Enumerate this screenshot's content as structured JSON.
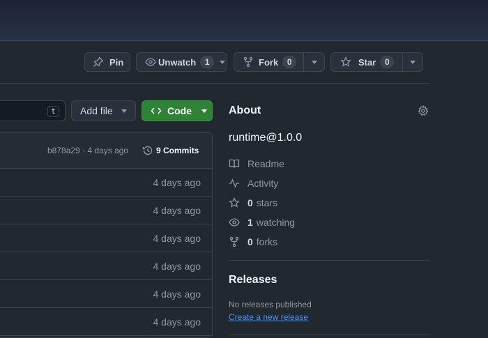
{
  "header": {
    "pin": {
      "label": "Pin"
    },
    "unwatch": {
      "label": "Unwatch",
      "count": "1"
    },
    "fork": {
      "label": "Fork",
      "count": "0"
    },
    "star": {
      "label": "Star",
      "count": "0"
    }
  },
  "toolbar": {
    "search_shortcut": "t",
    "add_file_label": "Add file",
    "code_label": "Code"
  },
  "commit_bar": {
    "summary": "b878a29 · 4 days ago",
    "commits_label": "9 Commits"
  },
  "files": [
    {
      "age": "4 days ago"
    },
    {
      "age": "4 days ago"
    },
    {
      "age": "4 days ago"
    },
    {
      "age": "4 days ago"
    },
    {
      "age": "4 days ago"
    },
    {
      "age": "4 days ago"
    }
  ],
  "about": {
    "title": "About",
    "description": "runtime@1.0.0",
    "readme_label": "Readme",
    "activity_label": "Activity",
    "stars_count": "0",
    "stars_label": "stars",
    "watching_count": "1",
    "watching_label": "watching",
    "forks_count": "0",
    "forks_label": "forks"
  },
  "releases": {
    "title": "Releases",
    "empty_text": "No releases published",
    "create_link": "Create a new release"
  },
  "colors": {
    "background": "#212830",
    "code_button": "#2f8338",
    "link": "#4493f8"
  }
}
